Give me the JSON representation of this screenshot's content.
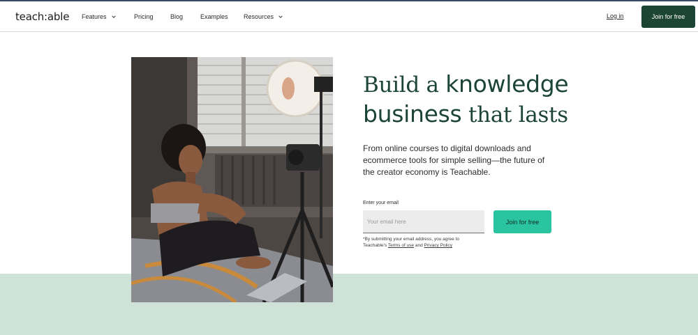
{
  "header": {
    "logo": "teach:able",
    "nav": [
      {
        "label": "Features",
        "has_dropdown": true
      },
      {
        "label": "Pricing",
        "has_dropdown": false
      },
      {
        "label": "Blog",
        "has_dropdown": false
      },
      {
        "label": "Examples",
        "has_dropdown": false
      },
      {
        "label": "Resources",
        "has_dropdown": true
      }
    ],
    "login": "Log in",
    "cta": "Join for free"
  },
  "hero": {
    "headline": {
      "part1": "Build a ",
      "part2": "knowledge",
      "part3": "business",
      "part4": " that lasts"
    },
    "subtext": "From online courses to digital downloads and ecommerce tools for simple selling—the future of the creator economy is Teachable.",
    "email_label": "Enter your email",
    "email_placeholder": "Your email here",
    "join_button": "Join for free",
    "disclaimer": {
      "prefix": "*By submitting your email address, you agree to Teachable's ",
      "terms": "Terms of use",
      "and": " and ",
      "privacy": "Privacy Policy"
    },
    "image_icon": "creator-photo"
  },
  "colors": {
    "brand_dark": "#1d4535",
    "accent": "#2bc4a0",
    "band": "#cfe2d8"
  }
}
